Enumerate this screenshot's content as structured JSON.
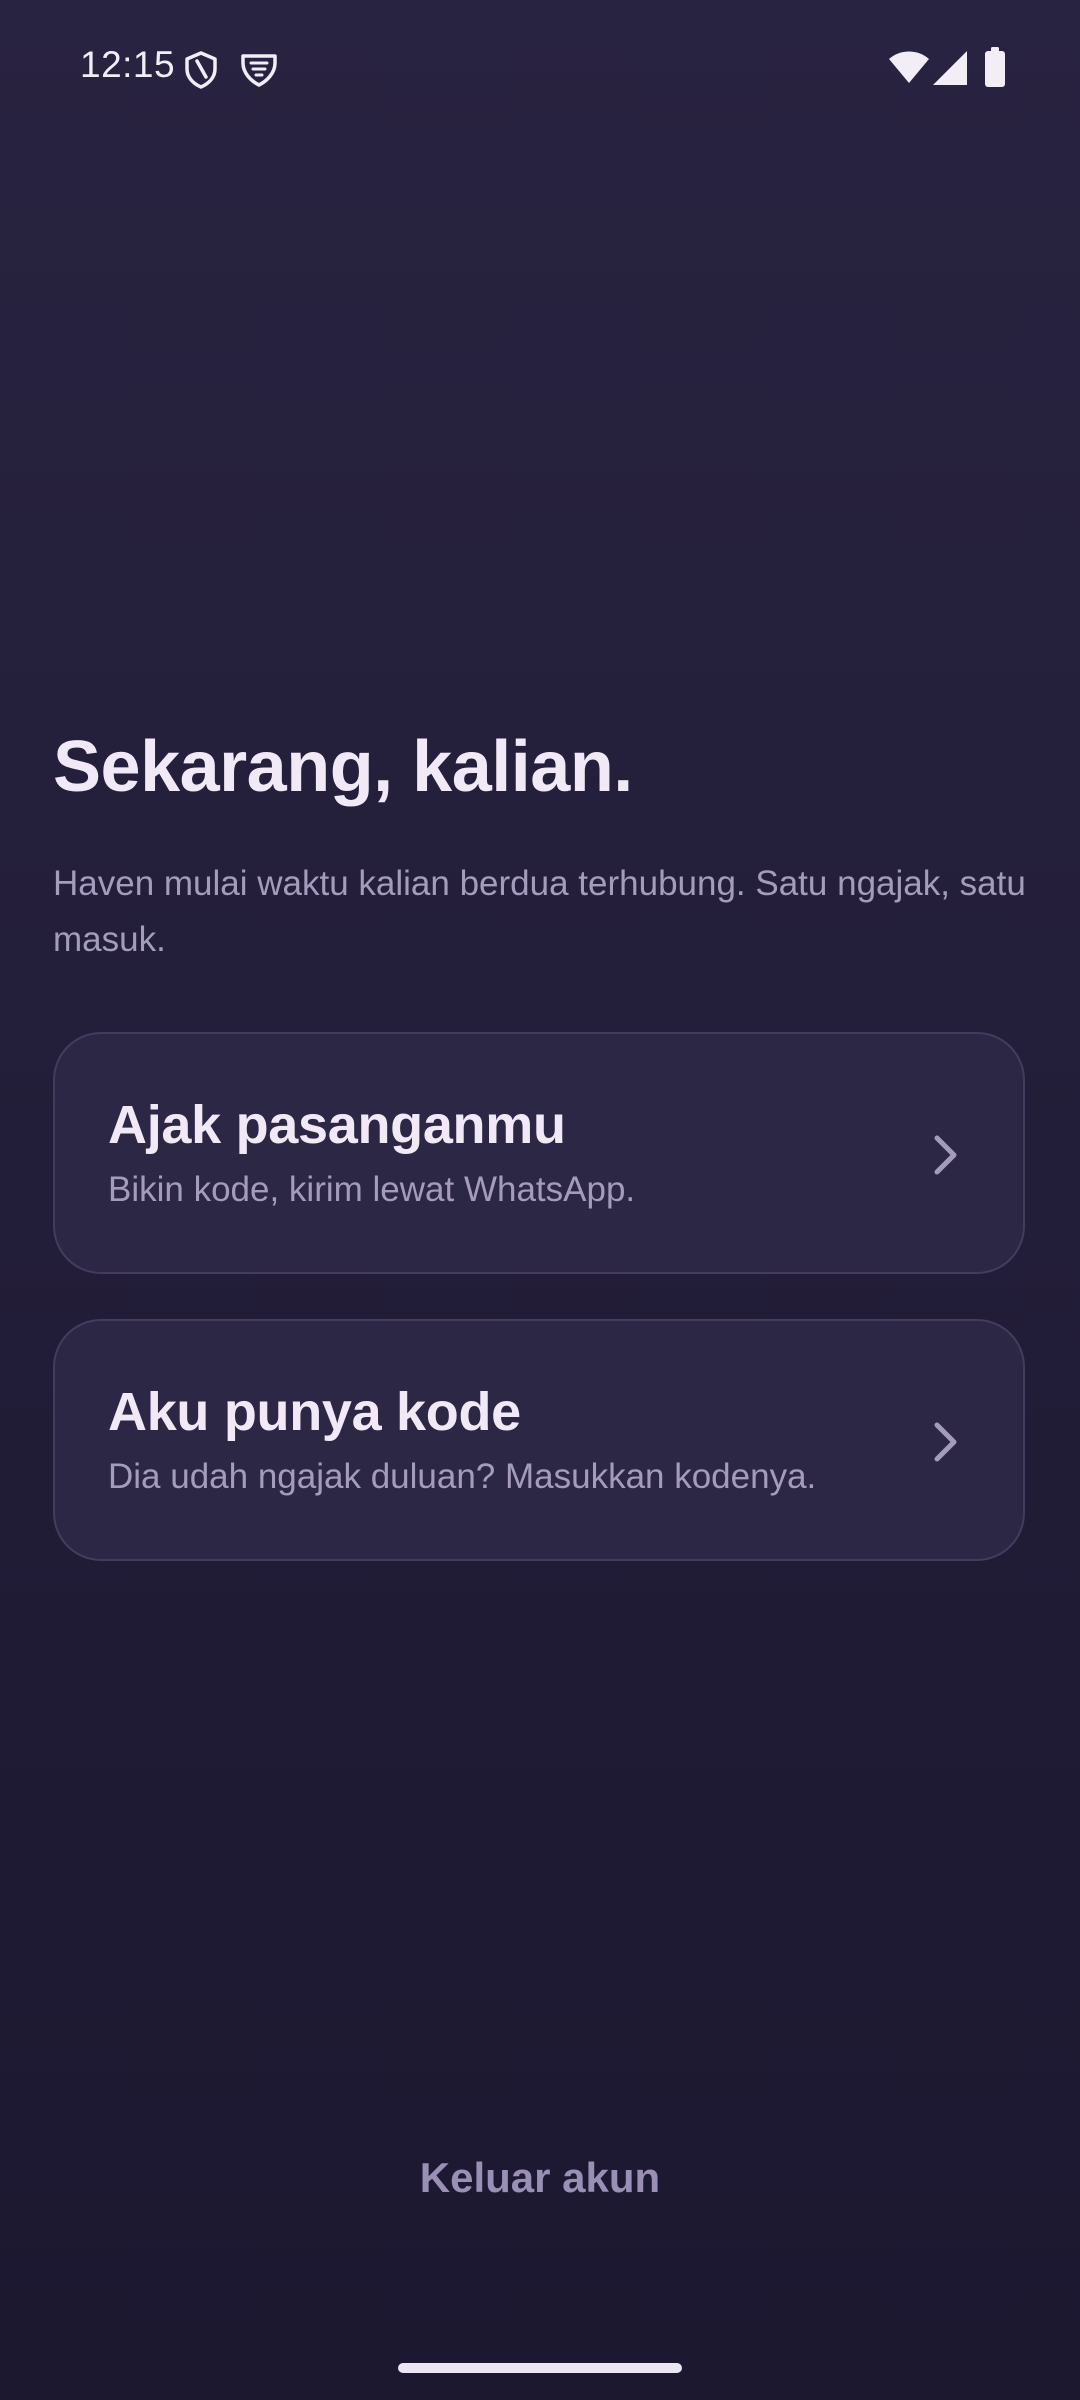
{
  "status_bar": {
    "time": "12:15",
    "left_icons": [
      "shield-icon",
      "vpn-shield-icon"
    ],
    "right_icons": [
      "wifi-icon",
      "cell-signal-icon",
      "battery-icon"
    ]
  },
  "main": {
    "title": "Sekarang, kalian.",
    "subtitle": "Haven mulai waktu kalian berdua terhubung. Satu ngajak, satu masuk.",
    "options": [
      {
        "title": "Ajak pasanganmu",
        "description": "Bikin kode, kirim lewat WhatsApp.",
        "icon": "chevron-right-icon"
      },
      {
        "title": "Aku punya kode",
        "description": "Dia udah ngajak duluan? Masukkan kodenya.",
        "icon": "chevron-right-icon"
      }
    ]
  },
  "footer": {
    "logout_label": "Keluar akun"
  },
  "colors": {
    "background_top": "#282340",
    "background_bottom": "#1c1830",
    "card_background": "#2d2746",
    "card_border": "#443c5e",
    "text_primary": "#f1e9f5",
    "text_secondary": "#a59cbb",
    "logout_text": "#9a8fb4"
  }
}
